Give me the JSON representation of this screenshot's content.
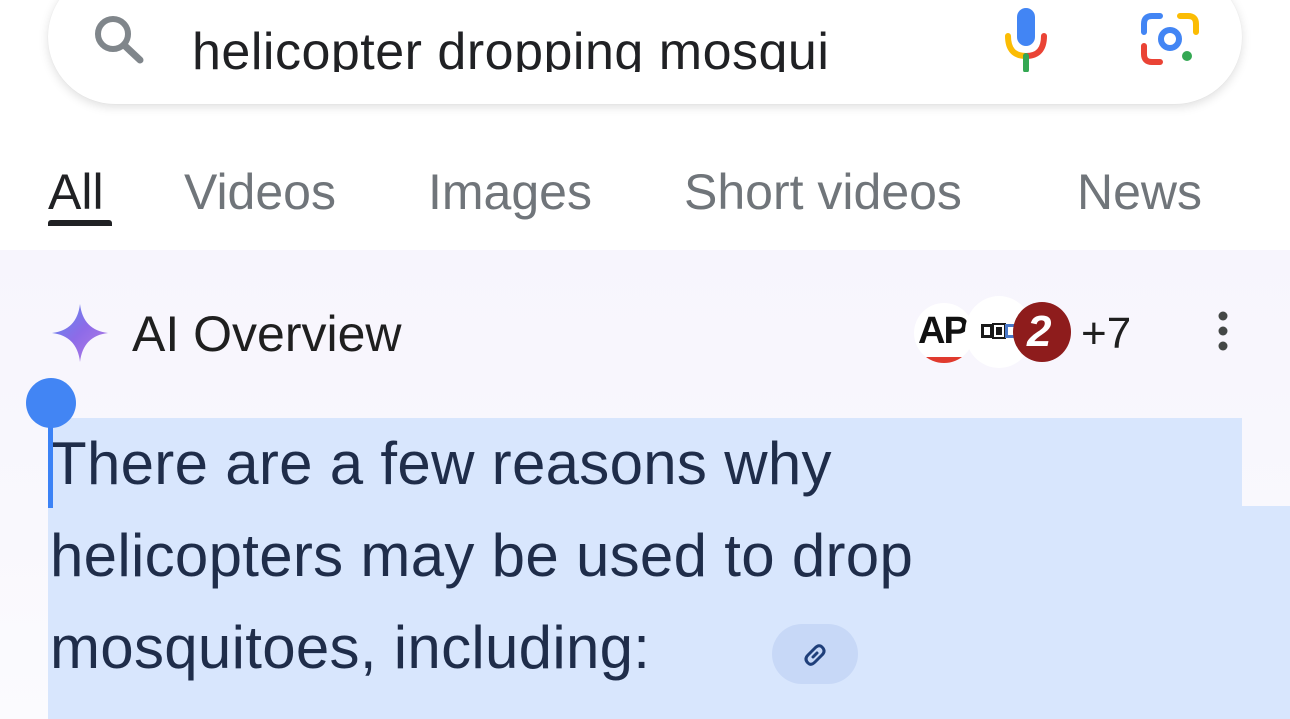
{
  "search": {
    "query": "helicopter dropping mosqui",
    "icons": {
      "search": "search-icon",
      "voice": "mic-icon",
      "lens": "google-lens-icon"
    }
  },
  "tabs": [
    {
      "label": "All",
      "active": true
    },
    {
      "label": "Videos",
      "active": false
    },
    {
      "label": "Images",
      "active": false
    },
    {
      "label": "Short videos",
      "active": false
    },
    {
      "label": "News",
      "active": false
    }
  ],
  "ai_overview": {
    "title": "AI Overview",
    "sources": [
      {
        "name": "AP",
        "badge": "AP"
      },
      {
        "name": "NPR",
        "badge": "npr"
      },
      {
        "name": "2",
        "badge": "2"
      }
    ],
    "more_sources": "+7",
    "body_lines": [
      "There are a few reasons why",
      "helicopters may be used to drop",
      "mosquitoes, including:"
    ]
  },
  "colors": {
    "selection": "#d8e6fd",
    "accent_blue": "#4285f4",
    "text": "#1f2d4a",
    "tab_inactive": "#70757a"
  }
}
